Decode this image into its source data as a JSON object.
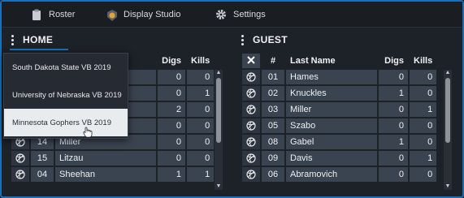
{
  "nav": {
    "tabs": [
      {
        "label": "Roster",
        "icon": "clipboard-icon"
      },
      {
        "label": "Display Studio",
        "icon": "shield-badge-icon"
      },
      {
        "label": "Settings",
        "icon": "gear-icon"
      }
    ]
  },
  "home": {
    "title": "HOME",
    "columns": {
      "digs": "Digs",
      "kills": "Kills"
    },
    "rows": [
      {
        "no": "",
        "name": "",
        "digs": "0",
        "kills": "0"
      },
      {
        "no": "",
        "name": "",
        "digs": "0",
        "kills": "1"
      },
      {
        "no": "",
        "name": "",
        "digs": "2",
        "kills": "0"
      },
      {
        "no": "",
        "name": "",
        "digs": "0",
        "kills": "0"
      },
      {
        "no": "14",
        "name": "Miller",
        "digs": "0",
        "kills": "0"
      },
      {
        "no": "15",
        "name": "Litzau",
        "digs": "0",
        "kills": "0"
      },
      {
        "no": "04",
        "name": "Sheehan",
        "digs": "1",
        "kills": "1"
      }
    ],
    "dropdown": [
      "South Dakota State VB 2019",
      "University of Nebraska VB 2019",
      "Minnesota Gophers VB 2019"
    ]
  },
  "guest": {
    "title": "GUEST",
    "columns": {
      "no": "#",
      "name": "Last Name",
      "digs": "Digs",
      "kills": "Kills"
    },
    "rows": [
      {
        "no": "01",
        "name": "Hames",
        "digs": "0",
        "kills": "0"
      },
      {
        "no": "02",
        "name": "Knuckles",
        "digs": "1",
        "kills": "0"
      },
      {
        "no": "03",
        "name": "Miller",
        "digs": "0",
        "kills": "1"
      },
      {
        "no": "05",
        "name": "Szabo",
        "digs": "0",
        "kills": "0"
      },
      {
        "no": "08",
        "name": "Gabel",
        "digs": "1",
        "kills": "0"
      },
      {
        "no": "09",
        "name": "Davis",
        "digs": "0",
        "kills": "1"
      },
      {
        "no": "06",
        "name": "Abramovich",
        "digs": "0",
        "kills": "0"
      }
    ]
  },
  "colors": {
    "accent": "#1b6fb8",
    "cell": "#3a4350",
    "background": "#1d2128"
  }
}
